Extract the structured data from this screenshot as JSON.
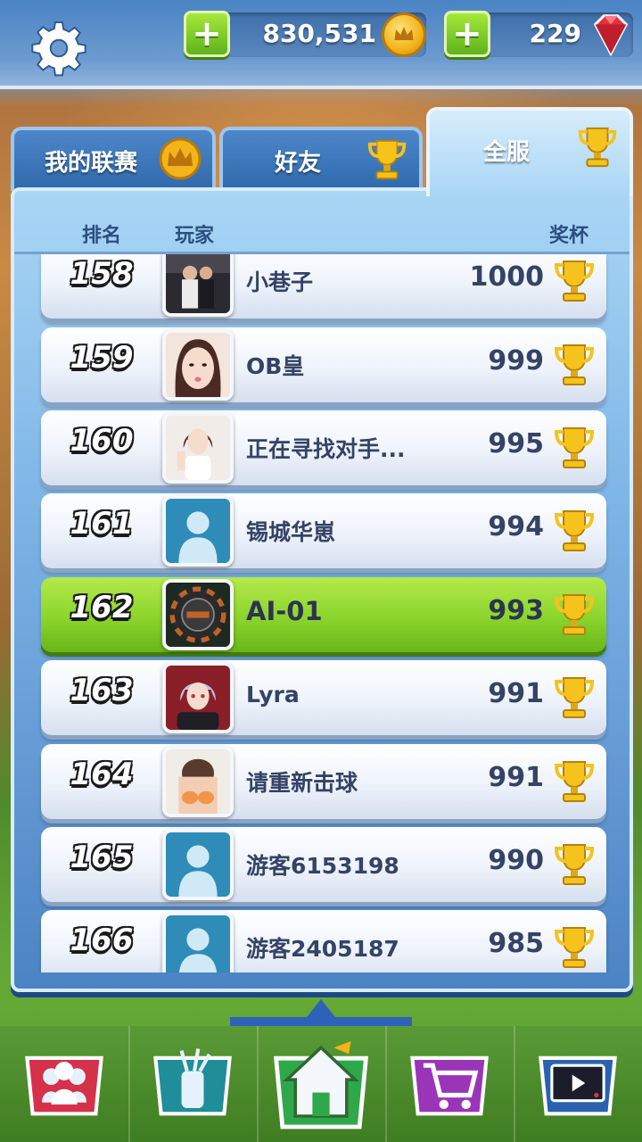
{
  "currency": {
    "coins": "830,531",
    "gems": "229",
    "plus_label": "+"
  },
  "tabs": [
    {
      "label": "我的联赛",
      "icon": "crown-coin-icon"
    },
    {
      "label": "好友",
      "icon": "trophy-icon"
    },
    {
      "label": "全服",
      "icon": "trophy-icon",
      "active": true
    }
  ],
  "leaderboard": {
    "headers": {
      "rank": "排名",
      "player": "玩家",
      "trophies": "奖杯"
    },
    "rows": [
      {
        "rank": "158",
        "name": "小巷子",
        "trophies": "1000",
        "avatar": "photo-couple"
      },
      {
        "rank": "159",
        "name": "OB皇",
        "trophies": "999",
        "avatar": "photo-girl"
      },
      {
        "rank": "160",
        "name": "正在寻找对手...",
        "trophies": "995",
        "avatar": "photo-girl-light"
      },
      {
        "rank": "161",
        "name": "锡城华崽",
        "trophies": "994",
        "avatar": "default-silhouette"
      },
      {
        "rank": "162",
        "name": "AI-01",
        "trophies": "993",
        "avatar": "poker-chip",
        "highlighted": true
      },
      {
        "rank": "163",
        "name": "Lyra",
        "trophies": "991",
        "avatar": "anime-character"
      },
      {
        "rank": "164",
        "name": "请重新击球",
        "trophies": "991",
        "avatar": "photo-woman"
      },
      {
        "rank": "165",
        "name": "游客6153198",
        "trophies": "990",
        "avatar": "default-silhouette"
      },
      {
        "rank": "166",
        "name": "游客2405187",
        "trophies": "985",
        "avatar": "default-silhouette"
      }
    ]
  },
  "bottom_nav": [
    "club-icon",
    "golf-bag-icon",
    "home-icon",
    "shop-cart-icon",
    "tv-replay-icon"
  ],
  "colors": {
    "highlight_row": "#8bd42c",
    "panel_blue": "#7cb4e6",
    "gold": "#f3b31a"
  }
}
